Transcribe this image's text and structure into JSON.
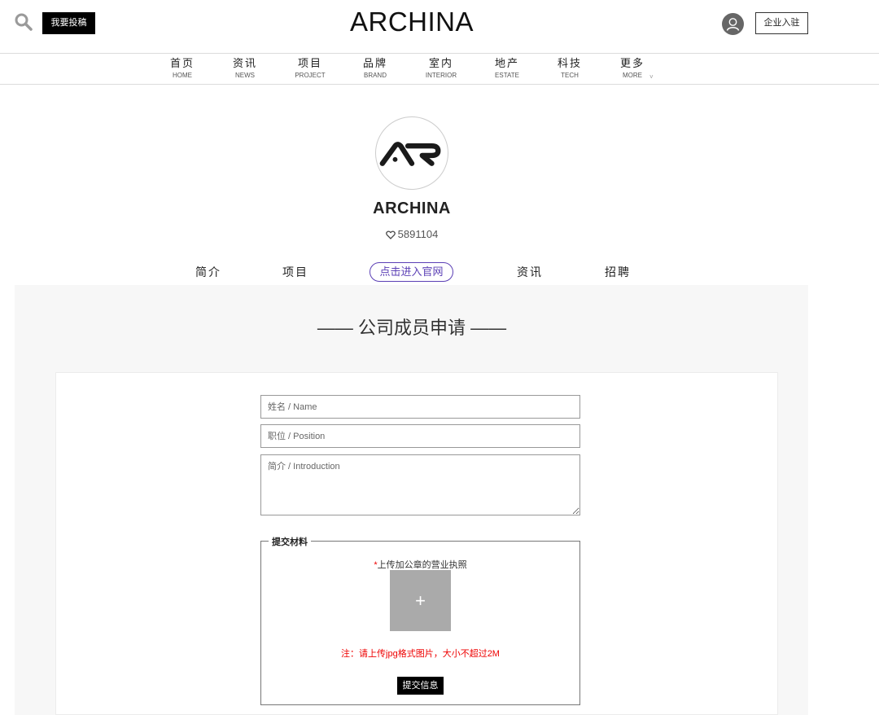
{
  "header": {
    "submit_label": "我要投稿",
    "logo": "ARCHINA",
    "enterprise_label": "企业入驻"
  },
  "nav": [
    {
      "cn": "首页",
      "en": "HOME"
    },
    {
      "cn": "资讯",
      "en": "NEWS"
    },
    {
      "cn": "项目",
      "en": "PROJECT"
    },
    {
      "cn": "品牌",
      "en": "BRAND"
    },
    {
      "cn": "室内",
      "en": "INTERIOR"
    },
    {
      "cn": "地产",
      "en": "ESTATE"
    },
    {
      "cn": "科技",
      "en": "TECH"
    },
    {
      "cn": "更多",
      "en": "MORE"
    }
  ],
  "profile": {
    "name": "ARCHINA",
    "likes": "5891104"
  },
  "subnav": {
    "intro": "简介",
    "projects": "项目",
    "official": "点击进入官网",
    "news": "资讯",
    "jobs": "招聘"
  },
  "form": {
    "title": "—— 公司成员申请 ——",
    "name_placeholder": "姓名 / Name",
    "position_placeholder": "职位 / Position",
    "intro_placeholder": "简介 / Introduction",
    "legend": "提交材料",
    "upload_required_mark": "*",
    "upload_label": "上传加公章的营业执照",
    "upload_plus": "+",
    "note": "注：请上传jpg格式图片，大小不超过2M",
    "submit_label": "提交信息"
  },
  "icons": {
    "search": "search-icon",
    "avatar": "user-avatar-icon",
    "heart": "heart-icon",
    "logo_mark": "ar-logo-mark"
  },
  "colors": {
    "accent_purple": "#5b3fb5",
    "panel_bg": "#f7f7f7",
    "note_red": "#e00000"
  }
}
